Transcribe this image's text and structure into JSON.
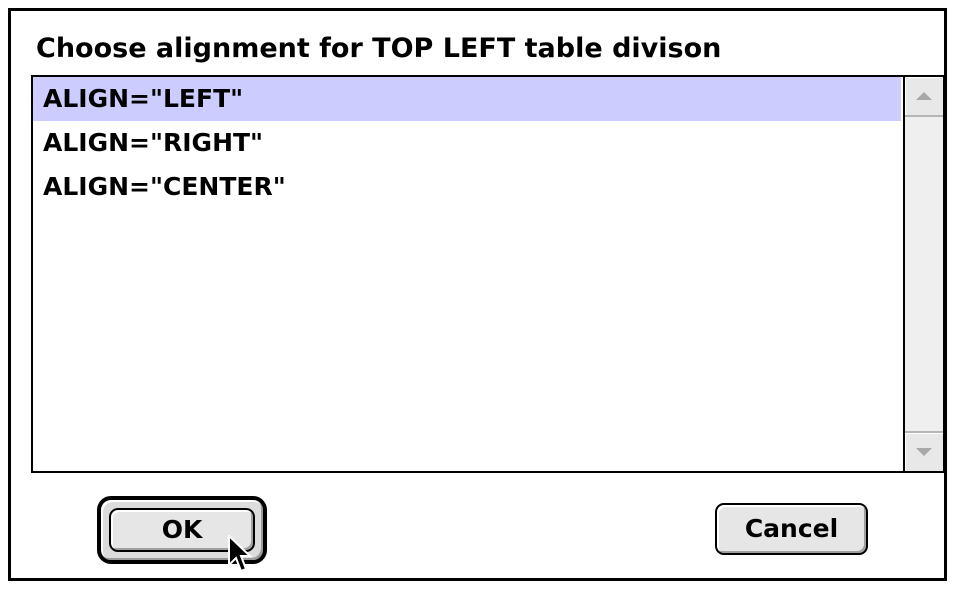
{
  "dialog": {
    "prompt": "Choose alignment for TOP LEFT table divison",
    "list": {
      "items": [
        {
          "label": "ALIGN=\"LEFT\"",
          "selected": true
        },
        {
          "label": "ALIGN=\"RIGHT\"",
          "selected": false
        },
        {
          "label": "ALIGN=\"CENTER\"",
          "selected": false
        }
      ],
      "selection_color": "#ccccff"
    },
    "buttons": {
      "ok_label": "OK",
      "cancel_label": "Cancel"
    }
  },
  "icons": {
    "scroll_up": "scroll-up-arrow-icon",
    "scroll_down": "scroll-down-arrow-icon",
    "cursor": "mouse-pointer-icon"
  }
}
